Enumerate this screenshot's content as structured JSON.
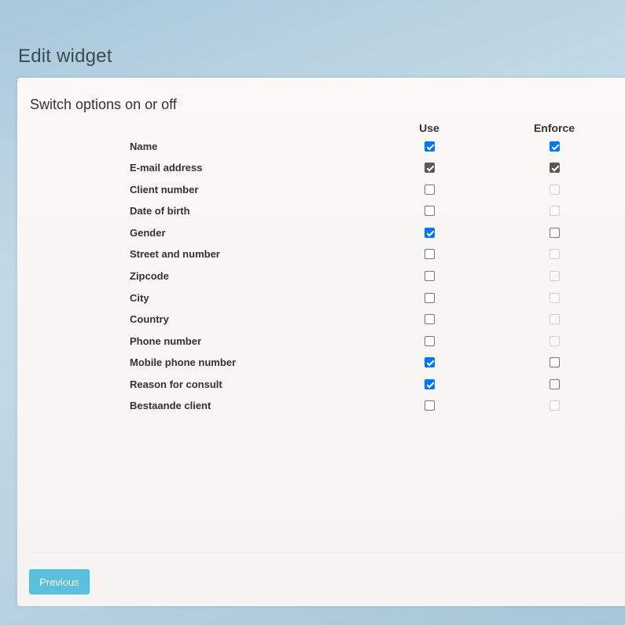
{
  "page": {
    "title": "Edit widget"
  },
  "card": {
    "section_title": "Switch options on or off",
    "columns": {
      "use": "Use",
      "enforce": "Enforce"
    },
    "rows": [
      {
        "label": "Name",
        "use": true,
        "enforce": true,
        "enforce_enabled": true,
        "style": "blue"
      },
      {
        "label": "E-mail address",
        "use": true,
        "enforce": true,
        "enforce_enabled": true,
        "style": "gray"
      },
      {
        "label": "Client number",
        "use": false,
        "enforce": false,
        "enforce_enabled": false,
        "style": "blue"
      },
      {
        "label": "Date of birth",
        "use": false,
        "enforce": false,
        "enforce_enabled": false,
        "style": "blue"
      },
      {
        "label": "Gender",
        "use": true,
        "enforce": false,
        "enforce_enabled": true,
        "style": "blue"
      },
      {
        "label": "Street and number",
        "use": false,
        "enforce": false,
        "enforce_enabled": false,
        "style": "blue"
      },
      {
        "label": "Zipcode",
        "use": false,
        "enforce": false,
        "enforce_enabled": false,
        "style": "blue"
      },
      {
        "label": "City",
        "use": false,
        "enforce": false,
        "enforce_enabled": false,
        "style": "blue"
      },
      {
        "label": "Country",
        "use": false,
        "enforce": false,
        "enforce_enabled": false,
        "style": "blue"
      },
      {
        "label": "Phone number",
        "use": false,
        "enforce": false,
        "enforce_enabled": false,
        "style": "blue"
      },
      {
        "label": "Mobile phone number",
        "use": true,
        "enforce": false,
        "enforce_enabled": true,
        "style": "blue"
      },
      {
        "label": "Reason for consult",
        "use": true,
        "enforce": false,
        "enforce_enabled": true,
        "style": "blue"
      },
      {
        "label": "Bestaande client",
        "use": false,
        "enforce": false,
        "enforce_enabled": false,
        "style": "blue"
      }
    ],
    "previous_button": "Previous"
  },
  "colors": {
    "checkbox_checked": "#0075ff",
    "checkbox_checked_locked": "#595959",
    "button_info": "#5bc0de"
  }
}
